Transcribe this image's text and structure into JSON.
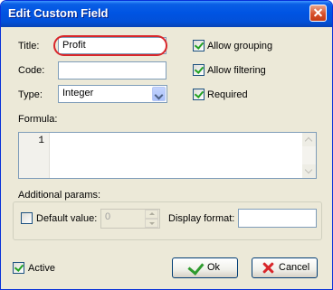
{
  "window": {
    "title": "Edit Custom Field"
  },
  "fields": {
    "title_label": "Title:",
    "title_value": "Profit",
    "code_label": "Code:",
    "code_value": "",
    "type_label": "Type:",
    "type_value": "Integer",
    "formula_label": "Formula:",
    "formula_line": "1"
  },
  "options": {
    "allow_grouping": {
      "label": "Allow grouping",
      "checked": true
    },
    "allow_filtering": {
      "label": "Allow filtering",
      "checked": true
    },
    "required": {
      "label": "Required",
      "checked": true
    }
  },
  "additional": {
    "label": "Additional params:",
    "default_value_label": "Default value:",
    "default_value": "0",
    "default_checked": false,
    "display_format_label": "Display format:",
    "display_format_value": ""
  },
  "active": {
    "label": "Active",
    "checked": true
  },
  "buttons": {
    "ok": "Ok",
    "cancel": "Cancel"
  },
  "colors": {
    "title_bar": "#0054e3",
    "highlight_ring": "#d9262a",
    "check": "#21a121"
  }
}
